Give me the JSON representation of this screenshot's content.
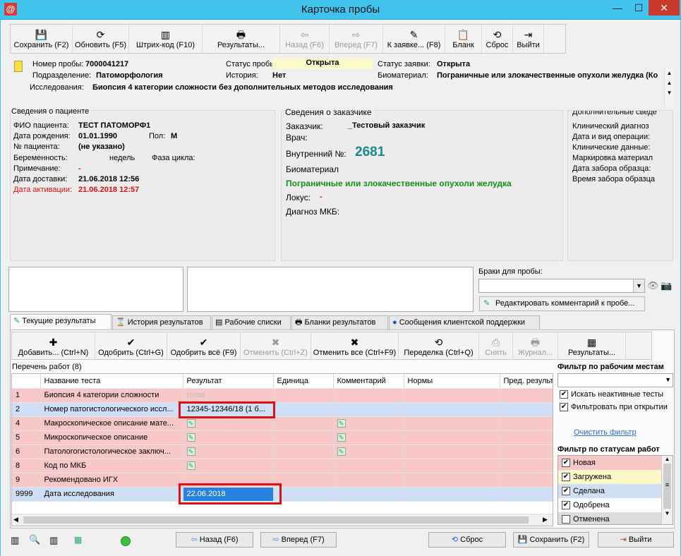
{
  "window": {
    "title": "Карточка пробы",
    "app_icon": "@",
    "minimize": "—",
    "maximize": "☐",
    "close": "✕"
  },
  "toolbar": [
    {
      "name": "save-button",
      "label": "Сохранить (F2)",
      "icon": "💾",
      "w": 88,
      "enabled": true
    },
    {
      "name": "refresh-button",
      "label": "Обновить (F5)",
      "icon": "⟳",
      "w": 80,
      "enabled": true
    },
    {
      "name": "barcode-button",
      "label": "Штрих-код (F10)",
      "icon": "▥",
      "w": 104,
      "enabled": true
    },
    {
      "name": "results-button",
      "label": "Результаты...",
      "icon": "🖶",
      "w": 110,
      "enabled": true
    },
    {
      "name": "back-button",
      "label": "Назад (F6)",
      "icon": "⇦",
      "w": 70,
      "enabled": false
    },
    {
      "name": "forward-button",
      "label": "Вперед (F7)",
      "icon": "⇨",
      "w": 76,
      "enabled": false
    },
    {
      "name": "to-order-button",
      "label": "К заявке... (F8)",
      "icon": "✎",
      "w": 88,
      "enabled": true
    },
    {
      "name": "blank-button",
      "label": "Бланк",
      "icon": "📋",
      "w": 52,
      "enabled": true
    },
    {
      "name": "reset-button",
      "label": "Сброс",
      "icon": "⟲",
      "w": 44,
      "enabled": true
    },
    {
      "name": "exit-button",
      "label": "Выйти",
      "icon": "⇥",
      "w": 44,
      "enabled": true
    }
  ],
  "header": {
    "sample_no_label": "Номер пробы:",
    "sample_no": "7000041217",
    "division_label": "Подразделение:",
    "division": "Патоморфология",
    "study_label": "Исследования:",
    "study": "Биопсия 4 категории сложности без дополнительных методов исследования",
    "sample_status_label": "Статус пробы:",
    "sample_status": "Открыта",
    "history_label": "История:",
    "history": "Нет",
    "order_status_label": "Статус заявки:",
    "order_status": "Открыта",
    "biomaterial_label": "Биоматериал:",
    "biomaterial": "Пограничные или злокачественные опухоли желудка (Ко"
  },
  "patient": {
    "title": "Сведения о пациенте",
    "fio_label": "ФИО пациента:",
    "fio": "ТЕСТ ПАТОМОРФ1",
    "dob_label": "Дата рождения:",
    "dob": "01.01.1990",
    "sex_label": "Пол:",
    "sex": "М",
    "no_label": "№ пациента:",
    "no": "(не указано)",
    "preg_label": "Беременность:",
    "weeks": "недель",
    "cycle_label": "Фаза цикла:",
    "note_label": "Примечание:",
    "note": "-",
    "delivery_label": "Дата доставки:",
    "delivery": "21.06.2018 12:56",
    "activation_label": "Дата активации:",
    "activation": "21.06.2018 12:57"
  },
  "customer": {
    "title": "Сведения о заказчике",
    "cust_label": "Заказчик:",
    "cust": "_Тестовый заказчик",
    "doctor_label": "Врач:",
    "internal_label": "Внутренний №:",
    "internal": "2681",
    "bio_label": "Биоматериал",
    "bio": "Пограничные или злокачественные опухоли желудка",
    "locus_label": "Локус:",
    "locus": "-",
    "mkb_label": "Диагноз МКБ:"
  },
  "extra": {
    "title": "Дополнительные сведе",
    "lines": [
      "Клинический диагноз",
      "Дата и вид операции:",
      "Клинические данные:",
      "Маркировка материал",
      "Дата забора образца:",
      "Время забора образца"
    ]
  },
  "defects": {
    "label": "Браки для пробы:",
    "edit_comment": "Редактировать комментарий к пробе..."
  },
  "tabs": [
    "Текущие результаты",
    "История результатов",
    "Рабочие списки",
    "Бланки результатов",
    "Сообщения клиентской поддержки"
  ],
  "results_toolbar": [
    {
      "name": "add-button",
      "label": "Добавить... (Ctrl+N)",
      "icon": "✚",
      "w": 118,
      "enabled": true
    },
    {
      "name": "approve-button",
      "label": "Одобрить (Ctrl+G)",
      "icon": "✔",
      "w": 102,
      "enabled": true
    },
    {
      "name": "approve-all-button",
      "label": "Одобрить всё (F9)",
      "icon": "✔",
      "w": 104,
      "enabled": true
    },
    {
      "name": "cancel-button",
      "label": "Отменить (Ctrl+Z)",
      "icon": "✖",
      "w": 100,
      "enabled": false
    },
    {
      "name": "cancel-all-button",
      "label": "Отменить все (Ctrl+F9)",
      "icon": "✖",
      "w": 124,
      "enabled": true
    },
    {
      "name": "rework-button",
      "label": "Переделка (Ctrl+Q)",
      "icon": "⟲",
      "w": 114,
      "enabled": true
    },
    {
      "name": "remove-button",
      "label": "Снять",
      "icon": "⎙",
      "w": 48,
      "enabled": false
    },
    {
      "name": "journal-button",
      "label": "Журнал...",
      "icon": "🖶",
      "w": 64,
      "enabled": false
    },
    {
      "name": "results2-button",
      "label": "Результаты...",
      "icon": "▦",
      "w": 96,
      "enabled": true
    }
  ],
  "worklist": {
    "title": "Перечень работ (8)",
    "columns": [
      "",
      "Название теста",
      "Результат",
      "Единица",
      "Комментарий",
      "Нормы",
      "Пред. результ"
    ],
    "rows": [
      {
        "id": "1",
        "name": "Биопсия 4 категории сложности",
        "result": "готов",
        "comment": false,
        "result_icon": false,
        "color": "#f8c8c8",
        "dim": true
      },
      {
        "id": "2",
        "name": "Номер патогистологического иссл...",
        "result": "12345-12346/18 (1 б...",
        "comment": false,
        "result_icon": false,
        "color": "#cfe0f6",
        "dim": false
      },
      {
        "id": "4",
        "name": "Макроскопическое описание мате...",
        "result": "",
        "comment": true,
        "result_icon": true,
        "color": "#f8c8c8",
        "dim": false
      },
      {
        "id": "5",
        "name": "Микроскопическое описание",
        "result": "",
        "comment": true,
        "result_icon": true,
        "color": "#f8c8c8",
        "dim": false
      },
      {
        "id": "6",
        "name": "Патологогистологическое заключ...",
        "result": "",
        "comment": true,
        "result_icon": true,
        "color": "#f8c8c8",
        "dim": false
      },
      {
        "id": "8",
        "name": "Код по МКБ",
        "result": "",
        "comment": false,
        "result_icon": true,
        "color": "#f8c8c8",
        "dim": false
      },
      {
        "id": "9",
        "name": "Рекомендовано ИГХ",
        "result": "",
        "comment": false,
        "result_icon": false,
        "color": "#f8c8c8",
        "dim": false
      },
      {
        "id": "9999",
        "name": "Дата исследования",
        "result": "22.06.2018",
        "comment": false,
        "result_icon": false,
        "color": "#cfe0f6",
        "dim": false
      }
    ]
  },
  "filters": {
    "workplace_title": "Фильтр по рабочим местам",
    "inactive_tests": "Искать неактивные тесты",
    "filter_on_open": "Фильтровать при открытии",
    "clear_filter": "Очистить фильтр",
    "status_title": "Фильтр по статусам работ",
    "statuses": [
      {
        "label": "Новая",
        "color": "#f8c8c8",
        "checked": true
      },
      {
        "label": "Загружена",
        "color": "#fcf8c8",
        "checked": true
      },
      {
        "label": "Сделана",
        "color": "#cfe0f6",
        "checked": true
      },
      {
        "label": "Одобрена",
        "color": "#ffffff",
        "checked": true
      },
      {
        "label": "Отменена",
        "color": "#dcdcdc",
        "checked": false
      }
    ]
  },
  "bottom": {
    "back": "Назад (F6)",
    "forward": "Вперед (F7)",
    "reset": "Сброс",
    "save": "Сохранить (F2)",
    "exit": "Выйти"
  }
}
